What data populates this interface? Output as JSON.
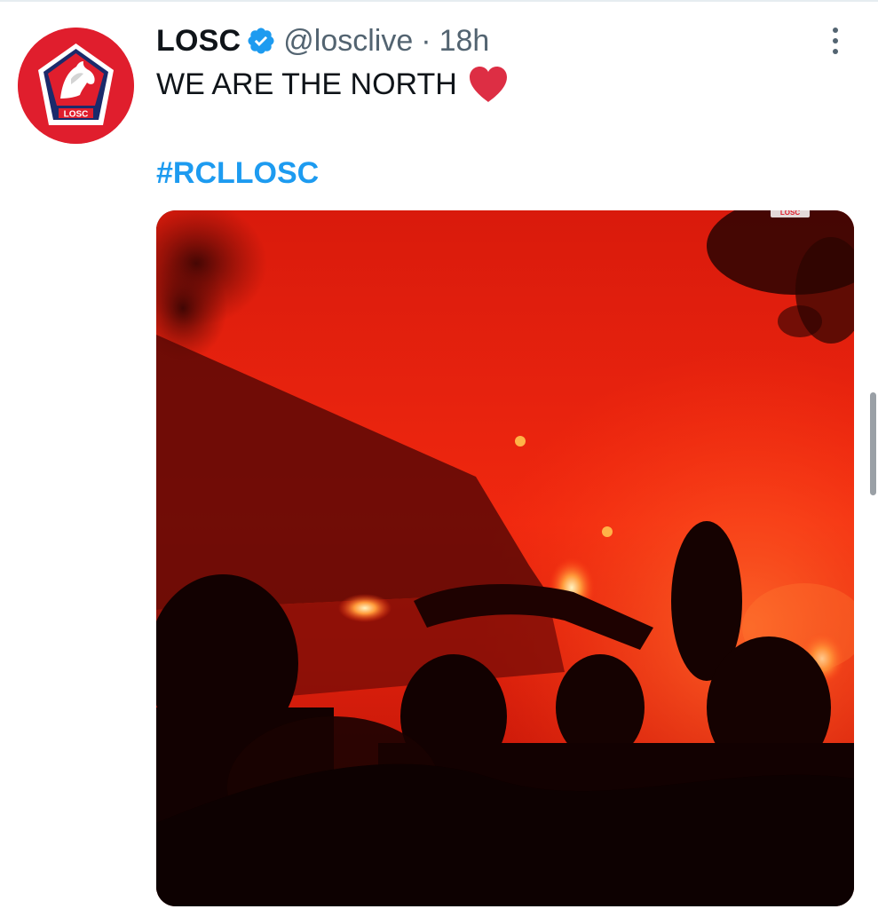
{
  "tweet": {
    "display_name": "LOSC",
    "handle": "@losclive",
    "separator": "·",
    "time": "18h",
    "text": "WE ARE THE NORTH",
    "hashtag": "#RCLLOSC",
    "avatar_text": "LOSC",
    "media_corner_badge": "LOSC"
  },
  "icons": {
    "verified": "verified-badge-icon",
    "heart": "red-heart-emoji-icon",
    "more": "more-options-icon"
  },
  "colors": {
    "brand_red": "#e01e2d",
    "verified_blue": "#1d9bf0",
    "hashtag_blue": "#1d9bf0",
    "heart_red": "#dd2e44",
    "text_primary": "#0f1419",
    "text_secondary": "#536471"
  }
}
